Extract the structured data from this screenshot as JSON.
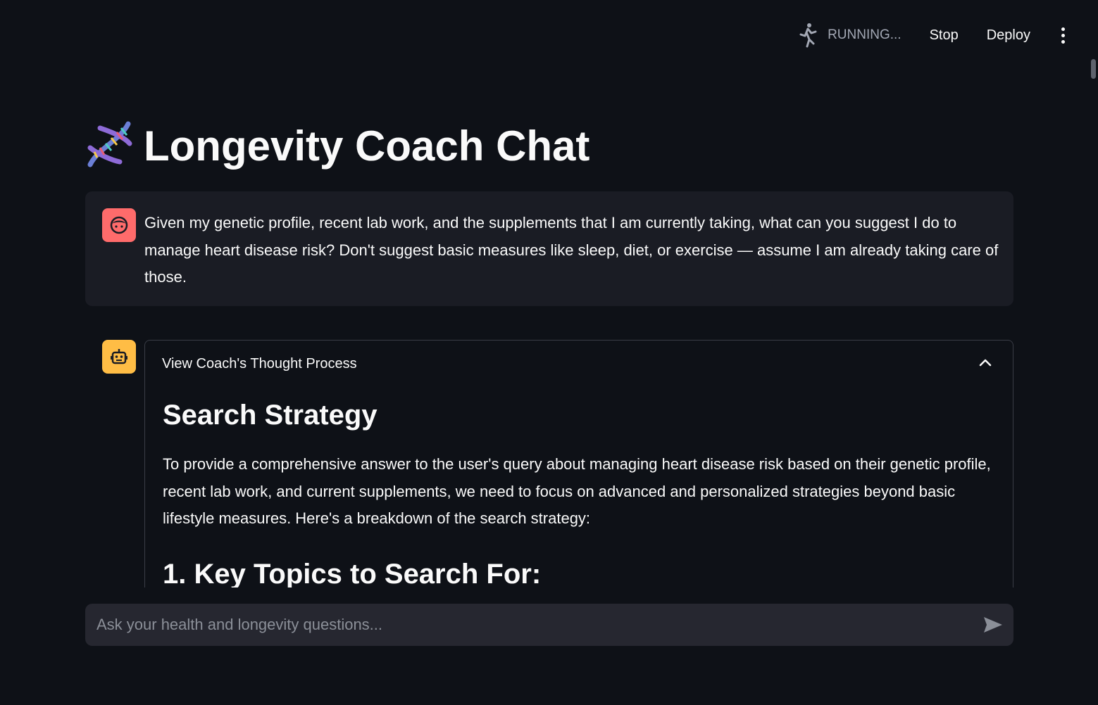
{
  "toolbar": {
    "status_icon": "running-person-icon",
    "status_text": "RUNNING...",
    "stop_label": "Stop",
    "deploy_label": "Deploy",
    "menu_icon": "kebab-menu-icon"
  },
  "page": {
    "title_icon": "dna-icon",
    "title": "Longevity Coach Chat"
  },
  "messages": [
    {
      "role": "user",
      "avatar_icon": "user-face-icon",
      "avatar_color": "#ff6b6b",
      "text": "Given my genetic profile, recent lab work, and the supplements that I am currently taking, what can you suggest I do to manage heart disease risk? Don't suggest basic measures like sleep, diet, or exercise — assume I am already taking care of those."
    },
    {
      "role": "assistant",
      "avatar_icon": "robot-icon",
      "avatar_color": "#ffbd45",
      "expander": {
        "label": "View Coach's Thought Process",
        "expanded": true,
        "heading": "Search Strategy",
        "paragraph": "To provide a comprehensive answer to the user's query about managing heart disease risk based on their genetic profile, recent lab work, and current supplements, we need to focus on advanced and personalized strategies beyond basic lifestyle measures. Here's a breakdown of the search strategy:",
        "subheading": "1. Key Topics to Search For:"
      }
    }
  ],
  "chat_input": {
    "placeholder": "Ask your health and longevity questions...",
    "value": "",
    "send_icon": "send-icon"
  },
  "colors": {
    "background": "#0e1117",
    "user_message_bg": "#1a1c24",
    "input_bg": "#262730",
    "text": "#fafafa",
    "muted": "#a3a8b4"
  }
}
